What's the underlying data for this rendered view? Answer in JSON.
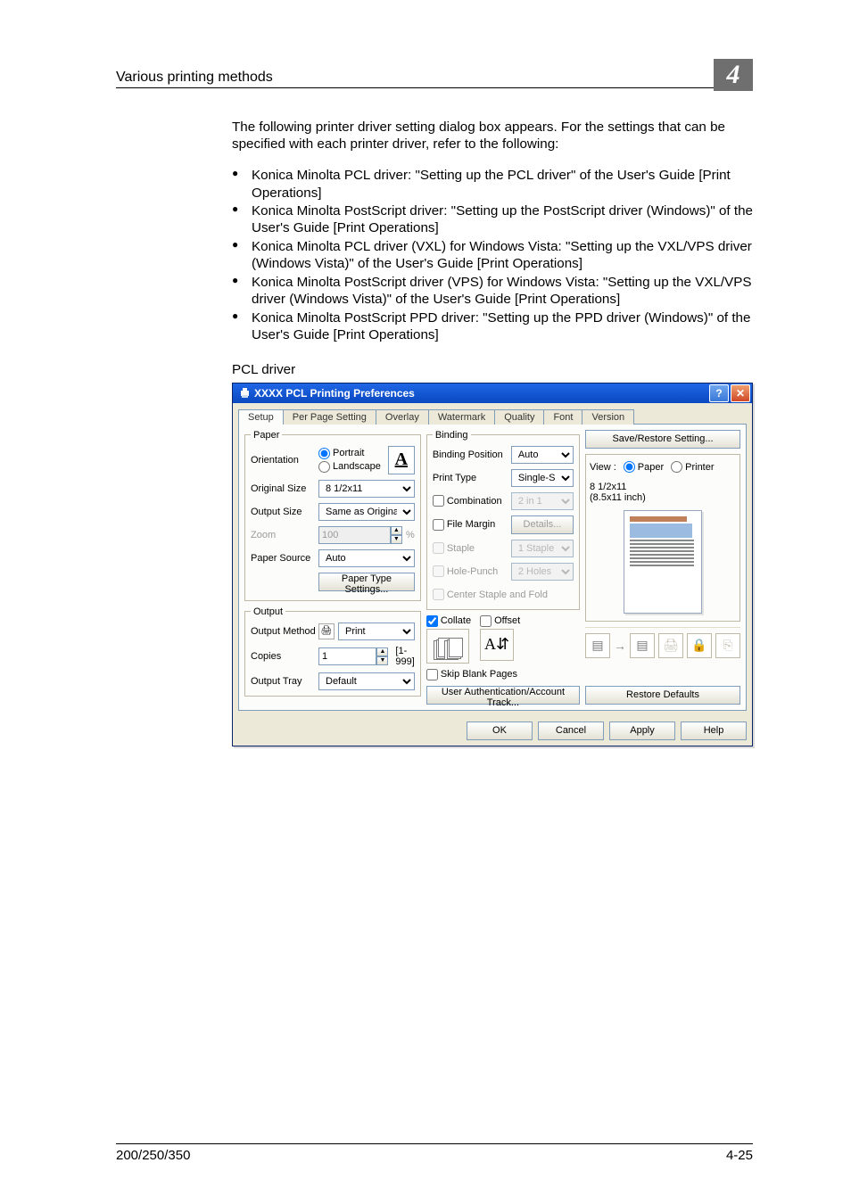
{
  "header": {
    "section_title": "Various printing methods",
    "chapter_number": "4"
  },
  "body": {
    "lead_text": "The following printer driver setting dialog box appears. For the settings that can be specified with each printer driver, refer to the following:",
    "bullets": [
      "Konica Minolta PCL driver: \"Setting up the PCL driver\" of the User's Guide [Print Operations]",
      "Konica Minolta PostScript driver: \"Setting up the PostScript driver (Windows)\" of the User's Guide [Print Operations]",
      "Konica Minolta PCL driver (VXL) for Windows Vista: \"Setting up the VXL/VPS driver (Windows Vista)\" of the User's Guide [Print Operations]",
      "Konica Minolta PostScript driver (VPS) for Windows Vista: \"Setting up the VXL/VPS driver (Windows Vista)\" of the User's Guide [Print Operations]",
      "Konica Minolta PostScript PPD driver: \"Setting up the PPD driver (Windows)\" of the User's Guide [Print Operations]"
    ],
    "driver_label": "PCL driver"
  },
  "dialog": {
    "title": "XXXX PCL Printing Preferences",
    "tabs": [
      "Setup",
      "Per Page Setting",
      "Overlay",
      "Watermark",
      "Quality",
      "Font",
      "Version"
    ],
    "groups": {
      "paper_legend": "Paper",
      "orientation_label": "Orientation",
      "portrait_label": "Portrait",
      "landscape_label": "Landscape",
      "original_size_label": "Original Size",
      "original_size_value": "8 1/2x11",
      "output_size_label": "Output Size",
      "output_size_value": "Same as Original Size",
      "zoom_label": "Zoom",
      "zoom_value": "100",
      "zoom_suffix": "%",
      "paper_source_label": "Paper Source",
      "paper_source_value": "Auto",
      "paper_type_btn": "Paper Type Settings...",
      "output_legend": "Output",
      "output_method_label": "Output Method",
      "output_method_value": "Print",
      "copies_label": "Copies",
      "copies_value": "1",
      "copies_range": "[1-999]",
      "output_tray_label": "Output Tray",
      "output_tray_value": "Default",
      "binding_legend": "Binding",
      "binding_position_label": "Binding Position",
      "binding_position_value": "Auto",
      "print_type_label": "Print Type",
      "print_type_value": "Single-Sided",
      "combination_label": "Combination",
      "combination_value": "2 in 1",
      "file_margin_label": "File Margin",
      "file_margin_btn": "Details...",
      "staple_label": "Staple",
      "staple_value": "1 Staple",
      "hole_punch_label": "Hole-Punch",
      "hole_punch_value": "2 Holes",
      "center_staple_label": "Center Staple and Fold",
      "collate_label": "Collate",
      "offset_label": "Offset",
      "skip_blank_label": "Skip Blank Pages",
      "user_auth_btn": "User Authentication/Account Track...",
      "save_restore_btn": "Save/Restore Setting...",
      "view_label": "View :",
      "view_paper_label": "Paper",
      "view_printer_label": "Printer",
      "view_size_line1": "8 1/2x11",
      "view_size_line2": "(8.5x11 inch)",
      "restore_defaults_btn": "Restore Defaults",
      "ok_btn": "OK",
      "cancel_btn": "Cancel",
      "apply_btn": "Apply",
      "help_btn": "Help"
    }
  },
  "footer": {
    "left": "200/250/350",
    "right": "4-25"
  }
}
